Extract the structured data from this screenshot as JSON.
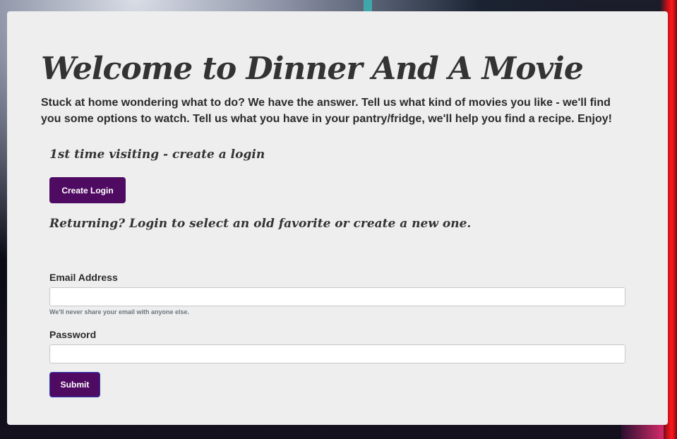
{
  "page": {
    "title": "Welcome to Dinner And A Movie",
    "intro": "Stuck at home wondering what to do? We have the answer. Tell us what kind of movies you like - we'll find you some options to watch. Tell us what you have in your pantry/fridge, we'll help you find a recipe. Enjoy!"
  },
  "signup": {
    "heading": "1st time visiting - create a login",
    "button_label": "Create Login"
  },
  "login": {
    "heading": "Returning? Login to select an old favorite or create a new one.",
    "email_label": "Email Address",
    "email_value": "",
    "email_help": "We'll never share your email with anyone else.",
    "password_label": "Password",
    "password_value": "",
    "submit_label": "Submit"
  },
  "colors": {
    "card_background": "#eeeeee",
    "button_background": "#4f0b62",
    "text": "#333333"
  }
}
